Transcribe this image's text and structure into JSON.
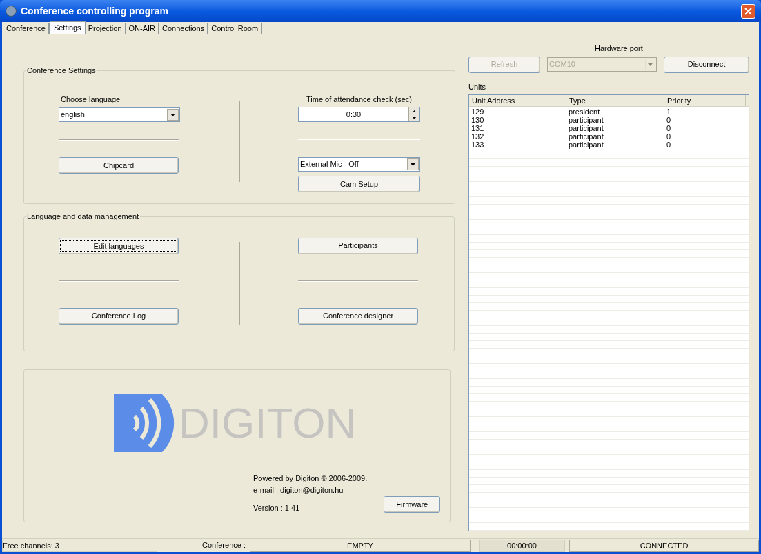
{
  "window": {
    "title": "Conference controlling program"
  },
  "tabs": [
    {
      "label": "Conference",
      "selected": false
    },
    {
      "label": "Settings",
      "selected": true
    },
    {
      "label": "Projection",
      "selected": false
    },
    {
      "label": "ON-AIR",
      "selected": false
    },
    {
      "label": "Connections",
      "selected": false
    },
    {
      "label": "Control Room",
      "selected": false
    }
  ],
  "conference_settings": {
    "title": "Conference Settings",
    "language_label": "Choose language",
    "language_value": "english",
    "time_label": "Time of attendance check (sec)",
    "time_value": "0:30",
    "chipcard_button": "Chipcard",
    "mic_value": "External Mic - Off",
    "cam_setup_button": "Cam Setup"
  },
  "data_management": {
    "title": "Language and data management",
    "buttons": [
      {
        "label": "Edit languages",
        "focused": true
      },
      {
        "label": "Participants",
        "focused": false
      },
      {
        "label": "Conference Log",
        "focused": false
      },
      {
        "label": "Conference designer",
        "focused": false
      }
    ]
  },
  "about": {
    "logo_text": "DIGITON",
    "powered": "Powered by Digiton © 2006-2009.",
    "email": "e-mail : digiton@digiton.hu",
    "version": "Version : 1.41",
    "firmware_button": "Firmware"
  },
  "hardware": {
    "label": "Hardware port",
    "refresh": {
      "label": "Refresh",
      "disabled": true
    },
    "port": {
      "value": "COM10",
      "disabled": true
    },
    "disconnect": {
      "label": "Disconnect",
      "disabled": false
    }
  },
  "units": {
    "label": "Units",
    "columns": [
      "Unit Address",
      "Type",
      "Priority"
    ],
    "rows": [
      [
        "129",
        "president",
        "1"
      ],
      [
        "130",
        "participant",
        "0"
      ],
      [
        "131",
        "participant",
        "0"
      ],
      [
        "132",
        "participant",
        "0"
      ],
      [
        "133",
        "participant",
        "0"
      ]
    ]
  },
  "status_bar": {
    "free_channels": "Free channels: 3",
    "conference_label": "Conference :",
    "conference_value": "EMPTY",
    "time": "00:00:00",
    "connection": "CONNECTED"
  }
}
